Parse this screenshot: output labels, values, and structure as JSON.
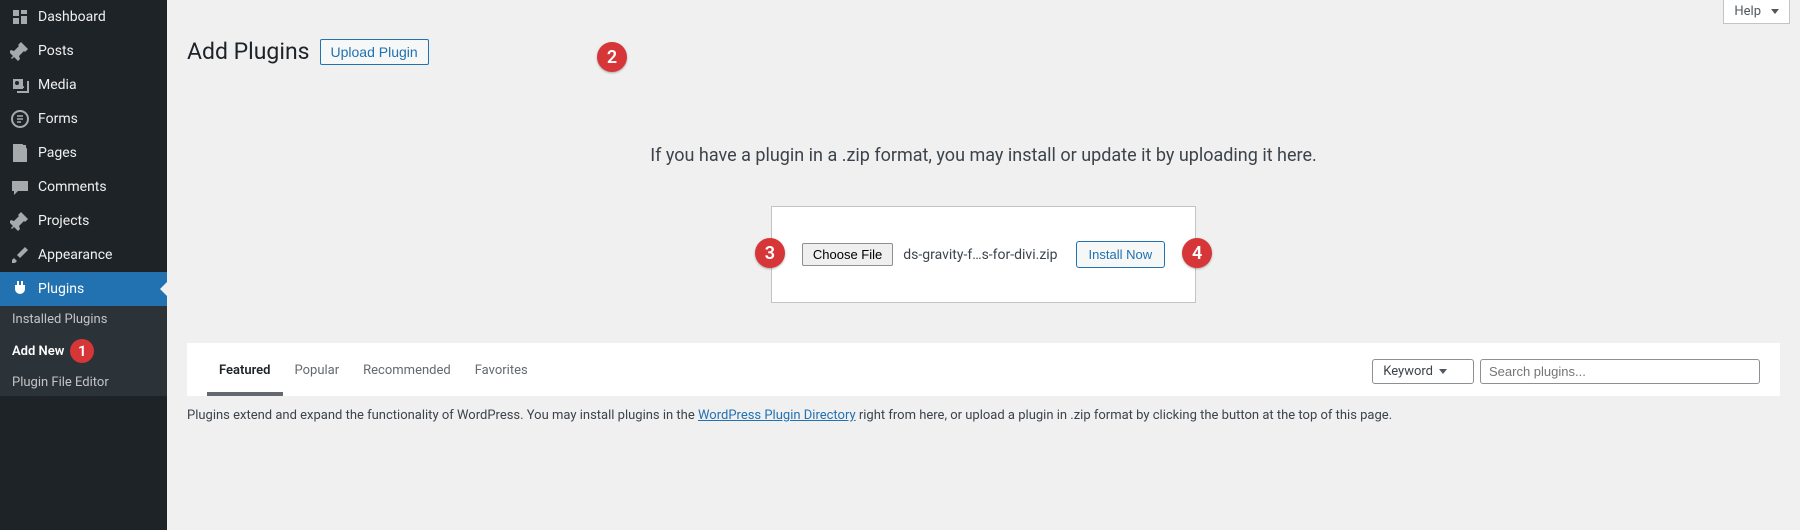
{
  "sidebar": {
    "items": [
      {
        "label": "Dashboard",
        "icon": "dashboard"
      },
      {
        "label": "Posts",
        "icon": "pin"
      },
      {
        "label": "Media",
        "icon": "media"
      },
      {
        "label": "Forms",
        "icon": "forms"
      },
      {
        "label": "Pages",
        "icon": "page"
      },
      {
        "label": "Comments",
        "icon": "comment"
      },
      {
        "label": "Projects",
        "icon": "pin"
      },
      {
        "label": "Appearance",
        "icon": "brush"
      },
      {
        "label": "Plugins",
        "icon": "plug"
      }
    ],
    "sub": {
      "installed": "Installed Plugins",
      "addnew": "Add New",
      "editor": "Plugin File Editor"
    }
  },
  "header": {
    "help": "Help",
    "title": "Add Plugins",
    "upload_btn": "Upload Plugin"
  },
  "upload": {
    "instruction": "If you have a plugin in a .zip format, you may install or update it by uploading it here.",
    "choose_file": "Choose File",
    "filename": "ds-gravity-f…s-for-divi.zip",
    "install_now": "Install Now"
  },
  "browser": {
    "tabs": {
      "featured": "Featured",
      "popular": "Popular",
      "recommended": "Recommended",
      "favorites": "Favorites"
    },
    "search_type": "Keyword",
    "search_placeholder": "Search plugins...",
    "desc_pre": "Plugins extend and expand the functionality of WordPress. You may install plugins in the ",
    "desc_link": "WordPress Plugin Directory",
    "desc_post": " right from here, or upload a plugin in .zip format by clicking the button at the top of this page."
  },
  "annotations": {
    "b1": "1",
    "b2": "2",
    "b3": "3",
    "b4": "4"
  }
}
